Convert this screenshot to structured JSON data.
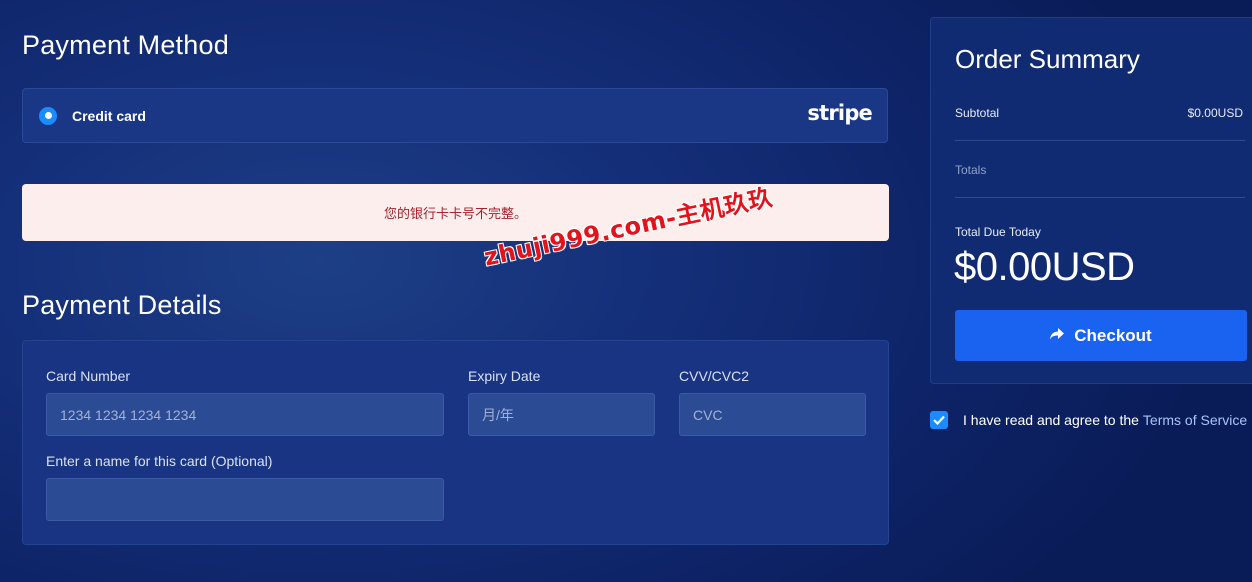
{
  "payment_method": {
    "title": "Payment Method",
    "option_label": "Credit card",
    "provider_logo": "stripe",
    "selected": true
  },
  "error": {
    "message": "您的银行卡卡号不完整。"
  },
  "watermark": {
    "text": "zhuji999.com-主机玖玖"
  },
  "payment_details": {
    "title": "Payment Details",
    "card_number": {
      "label": "Card Number",
      "placeholder": "1234 1234 1234 1234",
      "value": ""
    },
    "expiry": {
      "label": "Expiry Date",
      "placeholder": "月/年",
      "value": ""
    },
    "cvv": {
      "label": "CVV/CVC2",
      "placeholder": "CVC",
      "value": ""
    },
    "card_name": {
      "label": "Enter a name for this card (Optional)",
      "placeholder": "",
      "value": ""
    }
  },
  "order_summary": {
    "title": "Order Summary",
    "subtotal_label": "Subtotal",
    "subtotal_value": "$0.00USD",
    "totals_label": "Totals",
    "due_label": "Total Due Today",
    "due_value": "$0.00USD",
    "checkout_label": "Checkout",
    "checkout_icon": "share-arrow-icon"
  },
  "terms": {
    "checked": true,
    "text": "I have read and agree to the",
    "link": "Terms of Service"
  },
  "colors": {
    "accent": "#1a8cff",
    "button": "#1a63f0",
    "error_bg": "#fdeeee",
    "error_text": "#a3242c"
  }
}
